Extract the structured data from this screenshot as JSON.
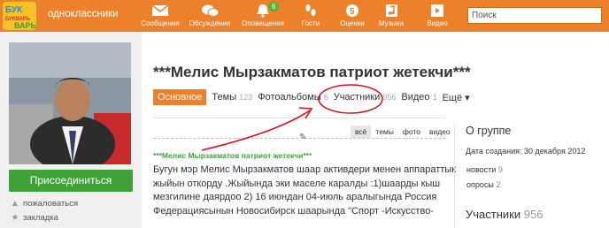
{
  "brand": "одноклассники",
  "logo_text": [
    "БУК",
    "БУКВАРЬ",
    "ВАРЬ"
  ],
  "nav": [
    {
      "label": "Сообщения",
      "icon": "envelope-icon"
    },
    {
      "label": "Обсуждения",
      "icon": "chat-bubbles-icon"
    },
    {
      "label": "Оповещения",
      "icon": "bell-icon",
      "badge": "6"
    },
    {
      "label": "Гости",
      "icon": "footprints-icon"
    },
    {
      "label": "Оценки",
      "icon": "ratings-icon"
    },
    {
      "label": "Музыка",
      "icon": "music-note-icon"
    },
    {
      "label": "Видео",
      "icon": "video-icon"
    }
  ],
  "search": {
    "value": "Поиск"
  },
  "sidebar": {
    "join_label": "Присоединиться",
    "links": [
      {
        "label": "пожаловаться",
        "icon": "warning-icon"
      },
      {
        "label": "закладка",
        "icon": "bookmark-icon"
      }
    ]
  },
  "group": {
    "title": "***Мелис Мырзакматов патриот жетекчи***",
    "tabs": [
      {
        "label": "Основное",
        "count": "",
        "active": true
      },
      {
        "label": "Темы",
        "count": "123"
      },
      {
        "label": "Фотоальбомы",
        "count": "6"
      },
      {
        "label": "Участники",
        "count": "956"
      },
      {
        "label": "Видео",
        "count": "1"
      },
      {
        "label": "Ещё ▾",
        "count": ""
      }
    ]
  },
  "feed_filters": [
    "всё",
    "темы",
    "фото",
    "видео"
  ],
  "post": {
    "title": "***Мелис Мырзакматов патриот жетекчи***",
    "lines": [
      "Бугун мэр Мелис Мырзакматов шаар активдери менен аппараттык",
      "жыйын откорду .Жыйында эки маселе каралды :1)шаарды кыш",
      "мезгилине даярдоо 2) 16 июндан 04-июль аралыгында Россия",
      "Федерациясынын Новосибирск шаарында \"Спорт -Искусство-"
    ]
  },
  "about": {
    "heading": "О группе",
    "created": "Дата создания: 30 декабря 2012",
    "links": [
      {
        "label": "новости",
        "count": "9"
      },
      {
        "label": "опросы",
        "count": "2"
      }
    ],
    "members_label": "Участники",
    "members_count": "956"
  },
  "colors": {
    "accent": "#ed812b",
    "join": "#3ea239",
    "annotation": "#d4101e"
  }
}
